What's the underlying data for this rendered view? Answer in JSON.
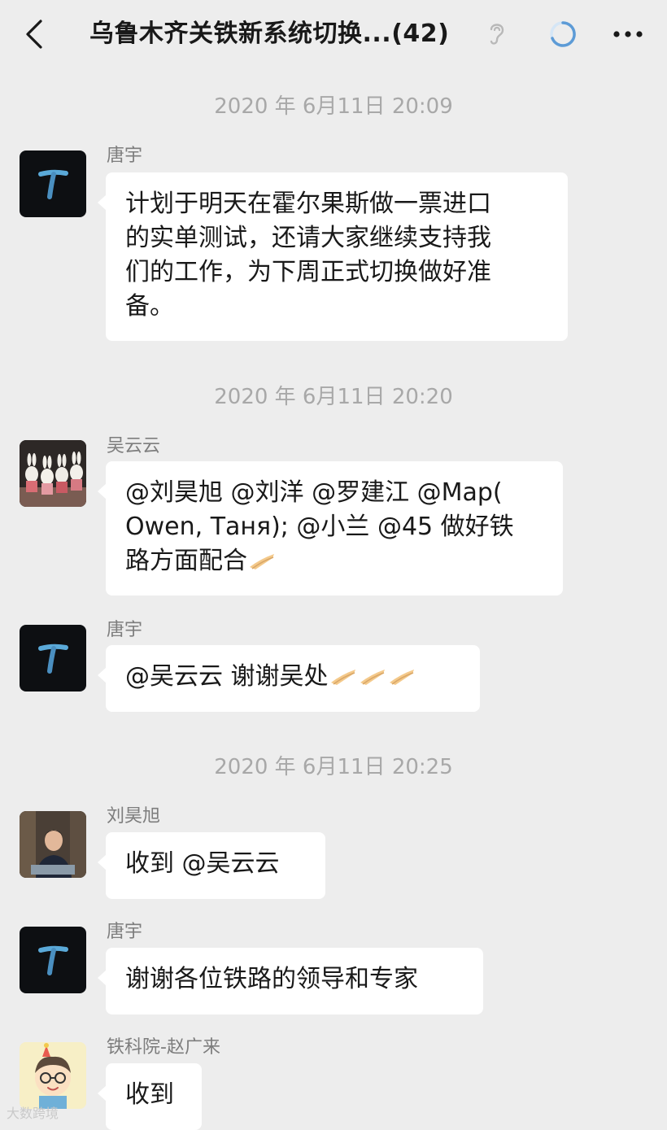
{
  "header": {
    "title": "乌鲁木齐关铁新系统切换...(42)",
    "back_icon": "chevron-left-icon",
    "ear_icon": "ear-icon",
    "loading_icon": "loading-ring-icon",
    "more_icon": "more-dots-icon"
  },
  "timestamps": [
    "2020 年 6月11日 20:09",
    "2020 年 6月11日 20:20",
    "2020 年 6月11日 20:25"
  ],
  "messages": [
    {
      "sender": "唐宇",
      "lines": [
        "计划于明天在霍尔果斯做一票进口",
        "的实单测试，还请大家继续支持我",
        "们的工作，为下周正式切换做好准",
        "备。"
      ]
    },
    {
      "sender": "吴云云",
      "lines": [
        "@刘昊旭 @刘洋 @罗建江 @Map(",
        "Owen, Таня); @小兰 @45 做好铁",
        "路方面配合"
      ]
    },
    {
      "sender": "唐宇",
      "lines": [
        "@吴云云 谢谢吴处"
      ]
    },
    {
      "sender": "刘昊旭",
      "lines": [
        "收到 @吴云云"
      ]
    },
    {
      "sender": "唐宇",
      "lines": [
        "谢谢各位铁路的领导和专家"
      ]
    },
    {
      "sender": "铁科院-赵广来",
      "lines": [
        "收到"
      ]
    }
  ],
  "emoji": {
    "name": "folded-hands-emoji",
    "color": "#f4c98a"
  },
  "watermark": "大数跨境",
  "colors": {
    "background": "#ededed",
    "bubble": "#ffffff",
    "timestamp": "#a8a8a8",
    "accent_ring": "#5d9bd6"
  }
}
